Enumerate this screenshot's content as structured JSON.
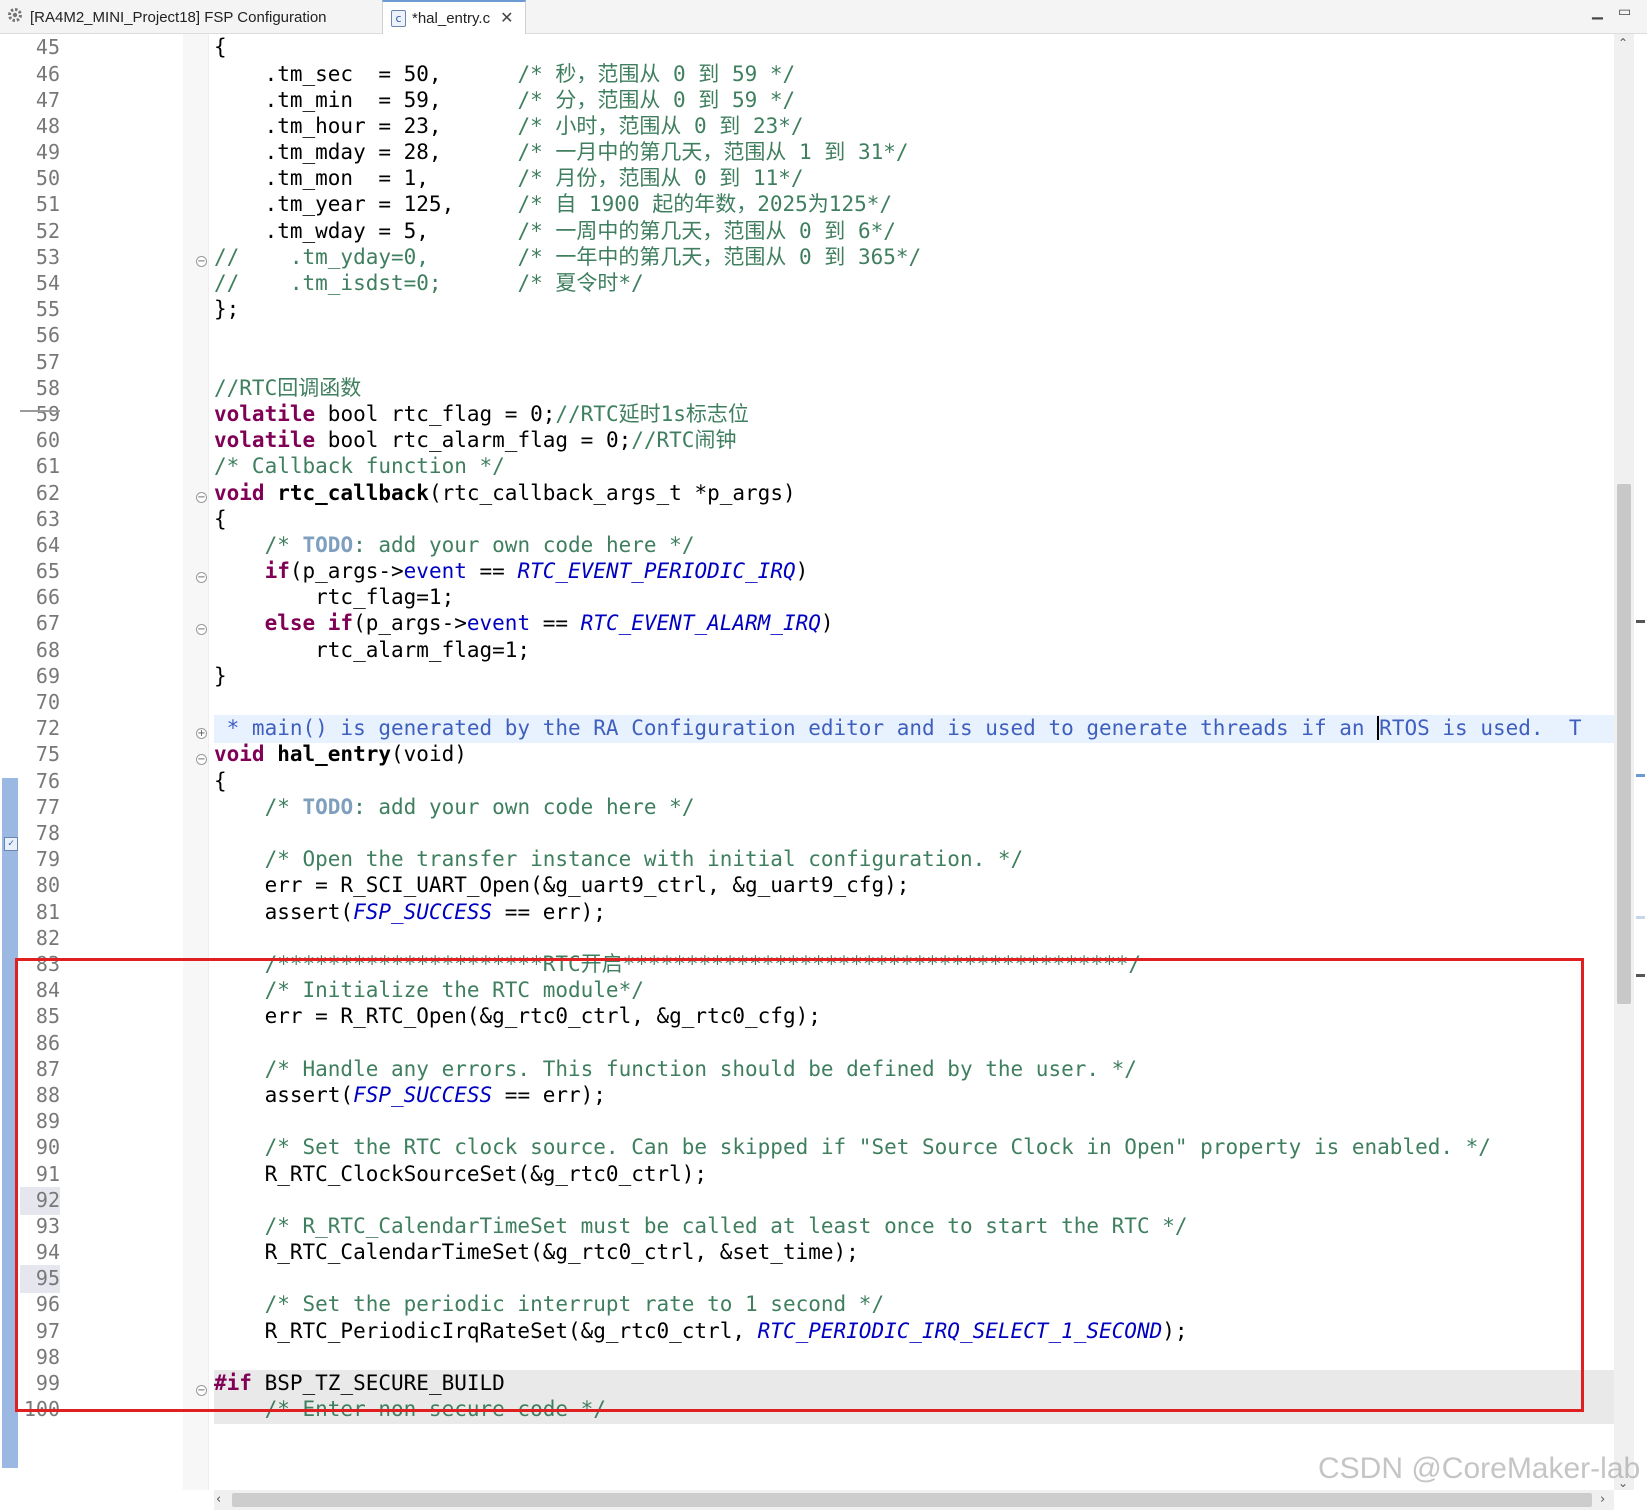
{
  "tabs": [
    {
      "label": "[RA4M2_MINI_Project18] FSP Configuration",
      "icon": "gear-icon"
    },
    {
      "label": "*hal_entry.c",
      "icon": "c-file-icon",
      "close": "✕"
    }
  ],
  "window": {
    "minimize": "▭",
    "maximize": "▭"
  },
  "editor": {
    "line_numbers": [
      "45",
      "46",
      "47",
      "48",
      "49",
      "50",
      "51",
      "52",
      "53",
      "54",
      "55",
      "56",
      "57",
      "58",
      "59",
      "60",
      "61",
      "62",
      "63",
      "64",
      "65",
      "66",
      "67",
      "68",
      "69",
      "70",
      "72",
      "75",
      "76",
      "77",
      "78",
      "79",
      "80",
      "81",
      "82",
      "83",
      "84",
      "85",
      "86",
      "87",
      "88",
      "89",
      "90",
      "91",
      "92",
      "93",
      "94",
      "95",
      "96",
      "97",
      "98",
      "99",
      "100"
    ],
    "lines": {
      "l45": "{",
      "l46a": "    .tm_sec  = 50,      ",
      "l46b": "/* 秒，范围从 0 到 59 */",
      "l47a": "    .tm_min  = 59,      ",
      "l47b": "/* 分，范围从 0 到 59 */",
      "l48a": "    .tm_hour = 23,      ",
      "l48b": "/* 小时，范围从 0 到 23*/",
      "l49a": "    .tm_mday = 28,      ",
      "l49b": "/* 一月中的第几天，范围从 1 到 31*/",
      "l50a": "    .tm_mon  = 1,       ",
      "l50b": "/* 月份，范围从 0 到 11*/",
      "l51a": "    .tm_year = 125,     ",
      "l51b": "/* 自 1900 起的年数，2025为125*/",
      "l52a": "    .tm_wday = 5,       ",
      "l52b": "/* 一周中的第几天，范围从 0 到 6*/",
      "l53a": "//    .tm_yday=0,       ",
      "l53b": "/* 一年中的第几天，范围从 0 到 365*/",
      "l54a": "//    .tm_isdst=0;      ",
      "l54b": "/* 夏令时*/",
      "l55": "};",
      "l58": "//RTC回调函数",
      "l59_kw": "volatile",
      "l59_rest": " bool rtc_flag = 0;",
      "l59_cm": "//RTC延时1s标志位",
      "l60_kw": "volatile",
      "l60_rest": " bool rtc_alarm_flag = 0;",
      "l60_cm": "//RTC闹钟",
      "l61": "/* Callback function */",
      "l62_kw": "void",
      "l62_fn": " rtc_callback",
      "l62_rest": "(rtc_callback_args_t *p_args)",
      "l63": "{",
      "l64a": "    /* ",
      "l64todo": "TODO",
      "l64b": ": add your own code here */",
      "l65_kw": "    if",
      "l65a": "(p_args->",
      "l65_field": "event",
      "l65b": " == ",
      "l65_mc": "RTC_EVENT_PERIODIC_IRQ",
      "l65c": ")",
      "l66": "        rtc_flag=1;",
      "l67_kw": "    else if",
      "l67a": "(p_args->",
      "l67_field": "event",
      "l67b": " == ",
      "l67_mc": "RTC_EVENT_ALARM_IRQ",
      "l67c": ")",
      "l68": "        rtc_alarm_flag=1;",
      "l69": "}",
      "l72a": " * main() is generated by the RA Configuration editor and is used to generate threads if an ",
      "l72b": "RTOS is used.  T",
      "l75_kw": "void",
      "l75_fn": " hal_entry",
      "l75_rest": "(void)",
      "l76": "{",
      "l77a": "    /* ",
      "l77todo": "TODO",
      "l77b": ": add your own code here */",
      "l79": "    /* Open the transfer instance with initial configuration. */",
      "l80": "    err = R_SCI_UART_Open(&g_uart9_ctrl, &g_uart9_cfg);",
      "l81a": "    assert(",
      "l81_mc": "FSP_SUCCESS",
      "l81b": " == err);",
      "l83": "    /*********************RTC开启****************************************/",
      "l84": "    /* Initialize the RTC module*/",
      "l85": "    err = R_RTC_Open(&g_rtc0_ctrl, &g_rtc0_cfg);",
      "l87": "    /* Handle any errors. This function should be defined by the user. */",
      "l88a": "    assert(",
      "l88_mc": "FSP_SUCCESS",
      "l88b": " == err);",
      "l90": "    /* Set the RTC clock source. Can be skipped if \"Set Source Clock in Open\" property is enabled. */",
      "l91": "    R_RTC_ClockSourceSet(&g_rtc0_ctrl);",
      "l93": "    /* R_RTC_CalendarTimeSet must be called at least once to start the RTC */",
      "l94": "    R_RTC_CalendarTimeSet(&g_rtc0_ctrl, &set_time);",
      "l96": "    /* Set the periodic interrupt rate to 1 second */",
      "l97a": "    R_RTC_PeriodicIrqRateSet(&g_rtc0_ctrl, ",
      "l97_mc": "RTC_PERIODIC_IRQ_SELECT_1_SECOND",
      "l97b": ");",
      "l99_kw": "#if",
      "l99_rest": " BSP_TZ_SECURE_BUILD",
      "l100": "    /* Enter non-secure code */"
    }
  },
  "colors": {
    "keyword": "#7f0055",
    "comment": "#3f7f5f",
    "doc_comment": "#3f5fbf",
    "macro": "#0000c0",
    "highlight_box": "#e02020"
  },
  "watermark": "CSDN @CoreMaker-lab"
}
